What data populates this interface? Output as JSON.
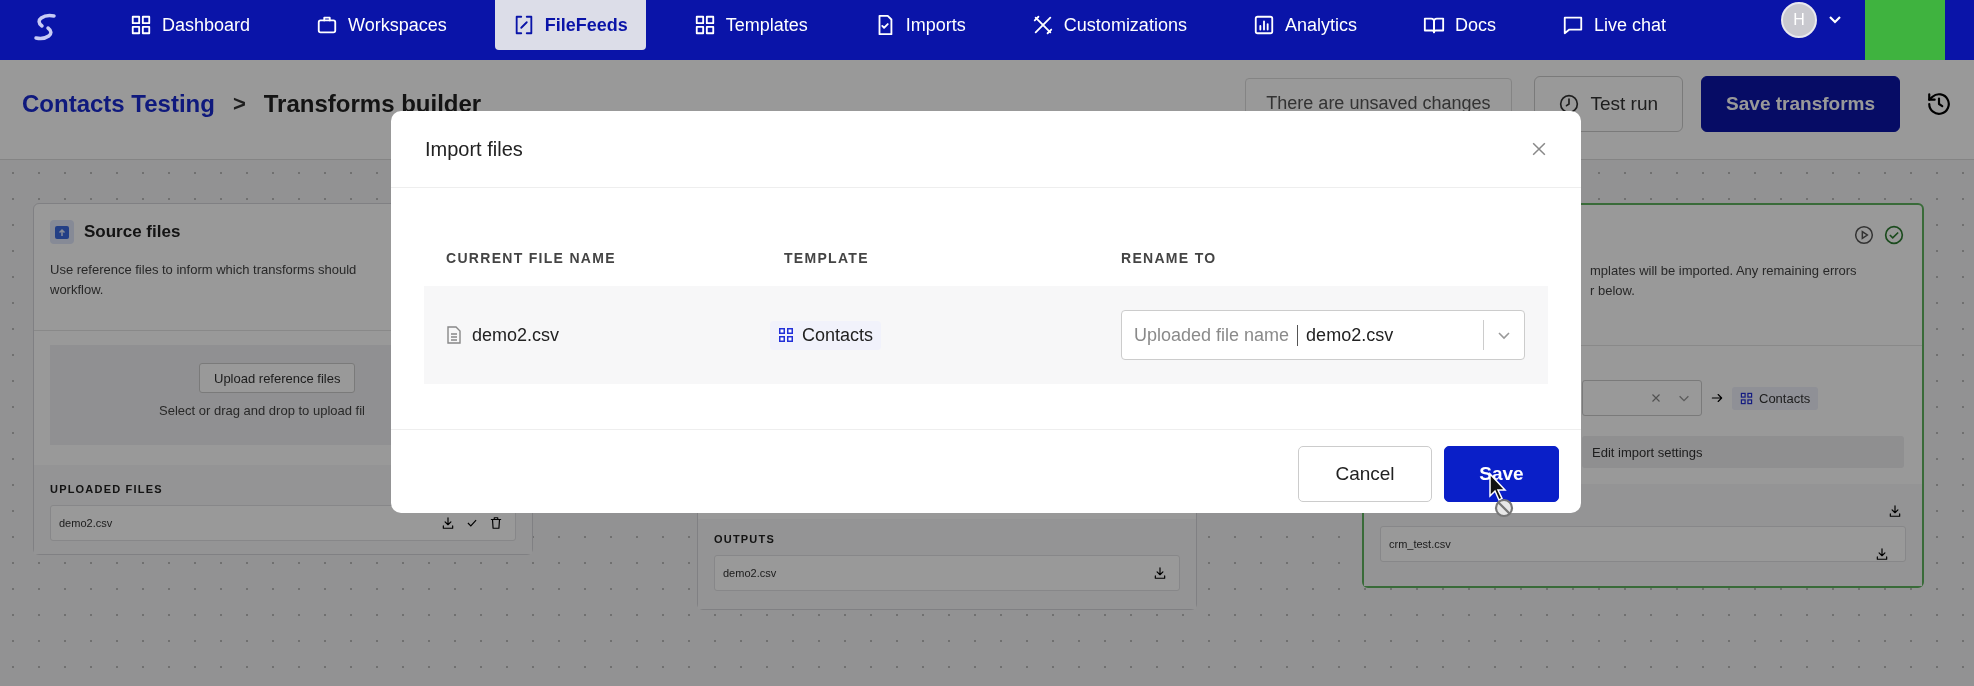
{
  "nav": {
    "items": [
      {
        "label": "Dashboard",
        "selected": false
      },
      {
        "label": "Workspaces",
        "selected": false
      },
      {
        "label": "FileFeeds",
        "selected": true
      },
      {
        "label": "Templates",
        "selected": false
      },
      {
        "label": "Imports",
        "selected": false
      },
      {
        "label": "Customizations",
        "selected": false
      },
      {
        "label": "Analytics",
        "selected": false
      },
      {
        "label": "Docs",
        "selected": false
      },
      {
        "label": "Live chat",
        "selected": false
      }
    ],
    "avatar": "H"
  },
  "header": {
    "breadcrumb": [
      {
        "label": "Contacts Testing",
        "kind": "link"
      },
      {
        "label": "Transforms builder",
        "kind": "current"
      }
    ],
    "separator": ">",
    "notice": "There are unsaved changes",
    "buttons": [
      {
        "label": "Test run",
        "kind": "secondary"
      },
      {
        "label": "Save transforms",
        "kind": "primary"
      }
    ]
  },
  "source_card": {
    "title": "Source files",
    "description_lines": [
      "Use reference files to inform which transforms should",
      "workflow."
    ],
    "upload_button": "Upload reference files",
    "upload_hint": "Select or drag and drop to upload fil",
    "files_label": "UPLOADED FILES",
    "files": [
      "demo2.csv"
    ]
  },
  "transform_card": {
    "outputs_label": "OUTPUTS",
    "files": [
      "demo2.csv"
    ]
  },
  "import_card": {
    "complete": true,
    "description_lines": [
      "mplates will be imported. Any remaining errors",
      "r below."
    ],
    "template": "Contacts",
    "settings_button": "Edit import settings",
    "files": [
      "crm_test.csv"
    ]
  },
  "modal": {
    "title": "Import files",
    "columns": [
      "CURRENT FILE NAME",
      "TEMPLATE",
      "RENAME TO"
    ],
    "rows": [
      {
        "file": "demo2.csv",
        "template": "Contacts",
        "rename_label": "Uploaded file name",
        "rename_value": "demo2.csv"
      }
    ],
    "buttons": [
      {
        "label": "Cancel",
        "kind": "secondary"
      },
      {
        "label": "Save",
        "kind": "primary"
      }
    ]
  }
}
